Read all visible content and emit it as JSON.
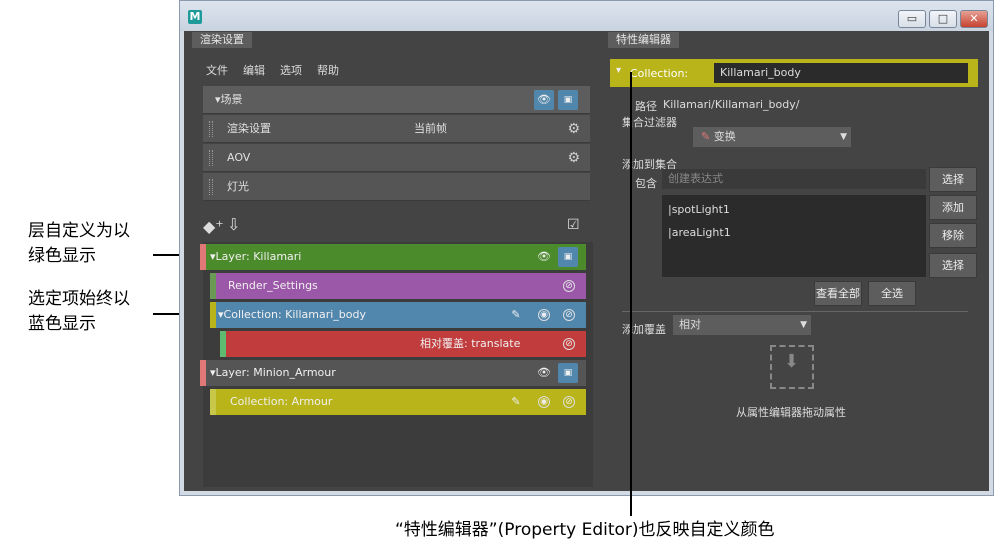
{
  "annotations": {
    "layer_custom_color": "层自定义为以\n绿色显示",
    "selected_blue": "选定项始终以\n蓝色显示",
    "property_editor": "“特性编辑器”(Property Editor)也反映自定义颜色"
  },
  "window": {
    "logo": "M",
    "buttons": [
      "▭",
      "□",
      "✕"
    ]
  },
  "left_panel": {
    "tab": "渲染设置",
    "menu": [
      "文件",
      "编辑",
      "选项",
      "帮助"
    ],
    "scene": {
      "header": "▾场景",
      "rows": [
        {
          "label": "渲染设置",
          "value": "当前帧"
        },
        {
          "label": "AOV",
          "value": ""
        },
        {
          "label": "灯光",
          "value": ""
        }
      ]
    },
    "layers": [
      {
        "type": "layer",
        "label": "Layer:  Killamari",
        "color": "#4c8b2b"
      },
      {
        "type": "collection",
        "label": "Render_Settings",
        "color": "#9b57a8"
      },
      {
        "type": "collection",
        "label": "Collection:  Killamari_body",
        "color": "#5287ad"
      },
      {
        "type": "override",
        "label": "相对覆盖:  translate",
        "color": "#c13c3c"
      },
      {
        "type": "layer",
        "label": "Layer:  Minion_Armour",
        "color": "#555555"
      },
      {
        "type": "collection",
        "label": "Collection:  Armour",
        "color": "#b8b419"
      }
    ]
  },
  "right_panel": {
    "tab": "特性编辑器",
    "collection_label": "Collection:",
    "collection_name": "Killamari_body",
    "path_label": "路径",
    "path_value": "Killamari/Killamari_body/",
    "filter_label": "集合过滤器",
    "filter_value": "变换",
    "add_to_collection_label": "添加到集合",
    "include_label": "包含",
    "include_placeholder": "创建表达式",
    "members": [
      "|spotLight1",
      "|areaLight1"
    ],
    "buttons": {
      "select": "选择",
      "add": "添加",
      "remove": "移除",
      "select2": "选择",
      "view_all": "查看全部",
      "select_all": "全选"
    },
    "override_label": "添加覆盖",
    "override_value": "相对",
    "drop_hint": "从属性编辑器拖动属性"
  }
}
